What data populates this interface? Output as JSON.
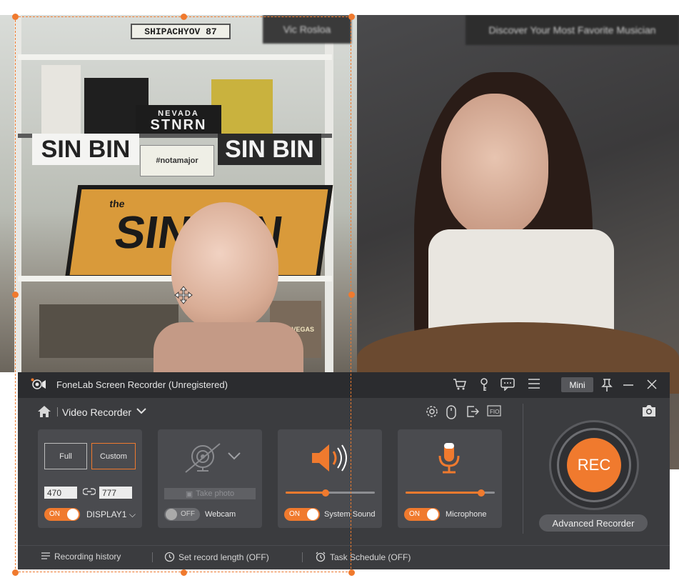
{
  "window": {
    "title": "FoneLab Screen Recorder (Unregistered)",
    "mini_label": "Mini"
  },
  "video": {
    "left_plate": "SHIPACHYOV 87",
    "left_sign1": "SIN BIN",
    "left_sign2": "SIN BIN",
    "left_nevada": "NEVADA",
    "left_plate2": "STNRN",
    "left_note": "#notamajor",
    "left_big_sign": "SIN BIN",
    "left_the": "the",
    "left_las_vegas": "LAS VEGAS"
  },
  "recorder": {
    "mode_label": "Video Recorder",
    "region": {
      "full_label": "Full",
      "custom_label": "Custom",
      "width": "470",
      "height": "777",
      "toggle_on": "ON",
      "display_label": "DISPLAY1"
    },
    "webcam": {
      "take_photo": "Take photo",
      "toggle_off": "OFF",
      "label": "Webcam"
    },
    "system_sound": {
      "toggle_on": "ON",
      "label": "System Sound",
      "level": 0.45
    },
    "microphone": {
      "toggle_on": "ON",
      "label": "Microphone",
      "level": 0.85
    },
    "rec_label": "REC",
    "advanced_label": "Advanced Recorder"
  },
  "footer": {
    "history": "Recording history",
    "length": "Set record length (OFF)",
    "schedule": "Task Schedule (OFF)"
  },
  "colors": {
    "accent": "#f07a2e",
    "panel_bg": "#3b3c3f",
    "titlebar_bg": "#2b2c2f",
    "card_bg": "#4a4b4f"
  }
}
